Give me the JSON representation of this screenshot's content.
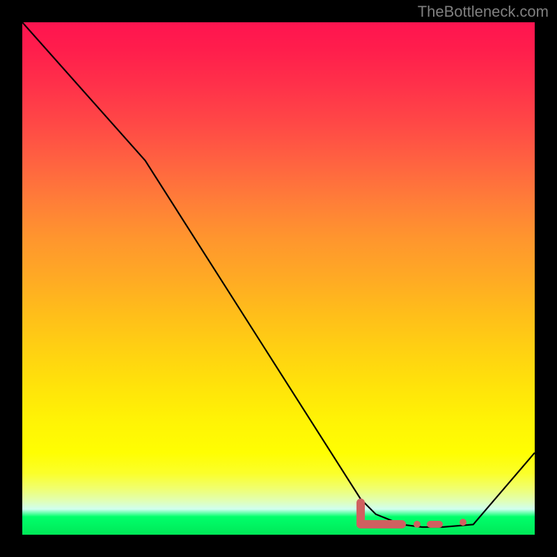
{
  "attribution": "TheBottleneck.com",
  "chart_data": {
    "type": "line",
    "title": "",
    "xlabel": "",
    "ylabel": "",
    "xlim": [
      0,
      100
    ],
    "ylim": [
      0,
      100
    ],
    "series": [
      {
        "name": "curve",
        "x": [
          0,
          24,
          66,
          69,
          74,
          78,
          82,
          88,
          100
        ],
        "y": [
          100,
          73,
          7,
          4,
          2,
          1.5,
          1.5,
          2,
          16
        ]
      }
    ],
    "markers": [
      {
        "shape": "L-bar",
        "x_start": 66,
        "x_end": 74,
        "y_vert_top": 7,
        "y_base": 2
      },
      {
        "shape": "dot",
        "x": 77,
        "y": 2
      },
      {
        "shape": "dash",
        "x_start": 79,
        "x_end": 82,
        "y": 2
      },
      {
        "shape": "dot",
        "x": 86,
        "y": 2.5
      }
    ],
    "marker_color": "#d06060",
    "gradient": {
      "stops": [
        {
          "pos": 0,
          "color": "#ff1450"
        },
        {
          "pos": 50,
          "color": "#ffaa24"
        },
        {
          "pos": 84,
          "color": "#fffe02"
        },
        {
          "pos": 96.5,
          "color": "#00ff6a"
        },
        {
          "pos": 100,
          "color": "#00e858"
        }
      ]
    }
  }
}
